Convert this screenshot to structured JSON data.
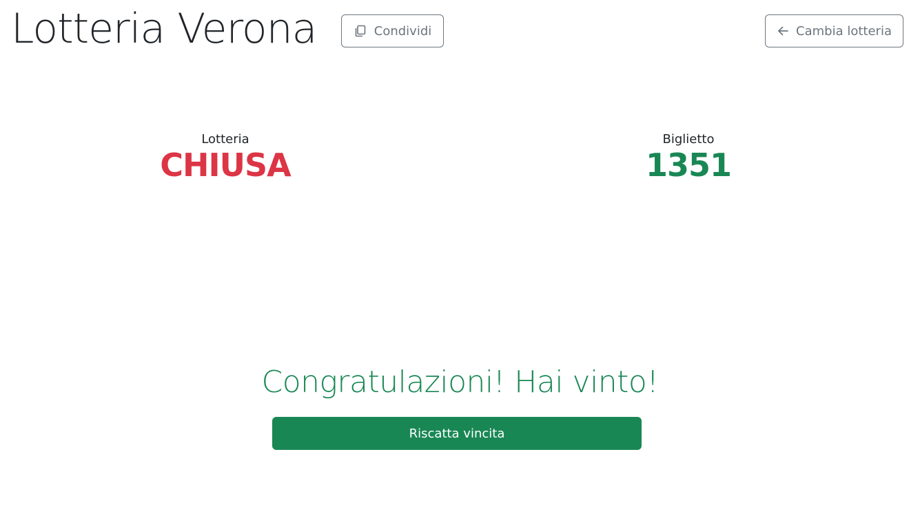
{
  "header": {
    "title": "Lotteria Verona",
    "share_label": "Condividi",
    "share_icon": "copy-icon",
    "change_label": "Cambia lotteria",
    "change_icon": "arrow-left-icon"
  },
  "status": {
    "lottery_label": "Lotteria",
    "lottery_value": "CHIUSA",
    "ticket_label": "Biglietto",
    "ticket_value": "1351"
  },
  "result": {
    "message": "Congratulazioni! Hai vinto!",
    "claim_label": "Riscatta vincita"
  },
  "colors": {
    "success": "#198754",
    "danger": "#dc3545",
    "secondary": "#6c757d"
  }
}
